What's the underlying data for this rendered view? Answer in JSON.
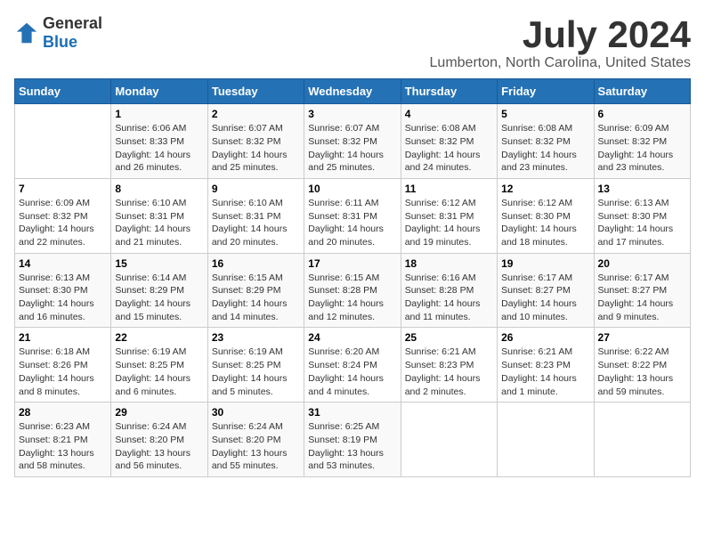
{
  "logo": {
    "general": "General",
    "blue": "Blue"
  },
  "title": "July 2024",
  "subtitle": "Lumberton, North Carolina, United States",
  "days_header": [
    "Sunday",
    "Monday",
    "Tuesday",
    "Wednesday",
    "Thursday",
    "Friday",
    "Saturday"
  ],
  "weeks": [
    [
      {
        "num": "",
        "info": ""
      },
      {
        "num": "1",
        "info": "Sunrise: 6:06 AM\nSunset: 8:33 PM\nDaylight: 14 hours\nand 26 minutes."
      },
      {
        "num": "2",
        "info": "Sunrise: 6:07 AM\nSunset: 8:32 PM\nDaylight: 14 hours\nand 25 minutes."
      },
      {
        "num": "3",
        "info": "Sunrise: 6:07 AM\nSunset: 8:32 PM\nDaylight: 14 hours\nand 25 minutes."
      },
      {
        "num": "4",
        "info": "Sunrise: 6:08 AM\nSunset: 8:32 PM\nDaylight: 14 hours\nand 24 minutes."
      },
      {
        "num": "5",
        "info": "Sunrise: 6:08 AM\nSunset: 8:32 PM\nDaylight: 14 hours\nand 23 minutes."
      },
      {
        "num": "6",
        "info": "Sunrise: 6:09 AM\nSunset: 8:32 PM\nDaylight: 14 hours\nand 23 minutes."
      }
    ],
    [
      {
        "num": "7",
        "info": "Sunrise: 6:09 AM\nSunset: 8:32 PM\nDaylight: 14 hours\nand 22 minutes."
      },
      {
        "num": "8",
        "info": "Sunrise: 6:10 AM\nSunset: 8:31 PM\nDaylight: 14 hours\nand 21 minutes."
      },
      {
        "num": "9",
        "info": "Sunrise: 6:10 AM\nSunset: 8:31 PM\nDaylight: 14 hours\nand 20 minutes."
      },
      {
        "num": "10",
        "info": "Sunrise: 6:11 AM\nSunset: 8:31 PM\nDaylight: 14 hours\nand 20 minutes."
      },
      {
        "num": "11",
        "info": "Sunrise: 6:12 AM\nSunset: 8:31 PM\nDaylight: 14 hours\nand 19 minutes."
      },
      {
        "num": "12",
        "info": "Sunrise: 6:12 AM\nSunset: 8:30 PM\nDaylight: 14 hours\nand 18 minutes."
      },
      {
        "num": "13",
        "info": "Sunrise: 6:13 AM\nSunset: 8:30 PM\nDaylight: 14 hours\nand 17 minutes."
      }
    ],
    [
      {
        "num": "14",
        "info": "Sunrise: 6:13 AM\nSunset: 8:30 PM\nDaylight: 14 hours\nand 16 minutes."
      },
      {
        "num": "15",
        "info": "Sunrise: 6:14 AM\nSunset: 8:29 PM\nDaylight: 14 hours\nand 15 minutes."
      },
      {
        "num": "16",
        "info": "Sunrise: 6:15 AM\nSunset: 8:29 PM\nDaylight: 14 hours\nand 14 minutes."
      },
      {
        "num": "17",
        "info": "Sunrise: 6:15 AM\nSunset: 8:28 PM\nDaylight: 14 hours\nand 12 minutes."
      },
      {
        "num": "18",
        "info": "Sunrise: 6:16 AM\nSunset: 8:28 PM\nDaylight: 14 hours\nand 11 minutes."
      },
      {
        "num": "19",
        "info": "Sunrise: 6:17 AM\nSunset: 8:27 PM\nDaylight: 14 hours\nand 10 minutes."
      },
      {
        "num": "20",
        "info": "Sunrise: 6:17 AM\nSunset: 8:27 PM\nDaylight: 14 hours\nand 9 minutes."
      }
    ],
    [
      {
        "num": "21",
        "info": "Sunrise: 6:18 AM\nSunset: 8:26 PM\nDaylight: 14 hours\nand 8 minutes."
      },
      {
        "num": "22",
        "info": "Sunrise: 6:19 AM\nSunset: 8:25 PM\nDaylight: 14 hours\nand 6 minutes."
      },
      {
        "num": "23",
        "info": "Sunrise: 6:19 AM\nSunset: 8:25 PM\nDaylight: 14 hours\nand 5 minutes."
      },
      {
        "num": "24",
        "info": "Sunrise: 6:20 AM\nSunset: 8:24 PM\nDaylight: 14 hours\nand 4 minutes."
      },
      {
        "num": "25",
        "info": "Sunrise: 6:21 AM\nSunset: 8:23 PM\nDaylight: 14 hours\nand 2 minutes."
      },
      {
        "num": "26",
        "info": "Sunrise: 6:21 AM\nSunset: 8:23 PM\nDaylight: 14 hours\nand 1 minute."
      },
      {
        "num": "27",
        "info": "Sunrise: 6:22 AM\nSunset: 8:22 PM\nDaylight: 13 hours\nand 59 minutes."
      }
    ],
    [
      {
        "num": "28",
        "info": "Sunrise: 6:23 AM\nSunset: 8:21 PM\nDaylight: 13 hours\nand 58 minutes."
      },
      {
        "num": "29",
        "info": "Sunrise: 6:24 AM\nSunset: 8:20 PM\nDaylight: 13 hours\nand 56 minutes."
      },
      {
        "num": "30",
        "info": "Sunrise: 6:24 AM\nSunset: 8:20 PM\nDaylight: 13 hours\nand 55 minutes."
      },
      {
        "num": "31",
        "info": "Sunrise: 6:25 AM\nSunset: 8:19 PM\nDaylight: 13 hours\nand 53 minutes."
      },
      {
        "num": "",
        "info": ""
      },
      {
        "num": "",
        "info": ""
      },
      {
        "num": "",
        "info": ""
      }
    ]
  ]
}
